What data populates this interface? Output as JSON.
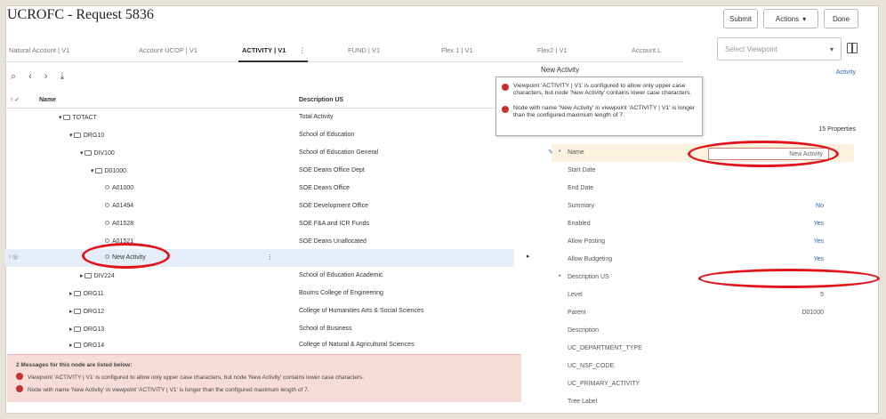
{
  "window": {
    "title": "UCROFC - Request 5836",
    "actions": {
      "submit": "Submit",
      "actions": "Actions",
      "done": "Done"
    }
  },
  "tabs": [
    {
      "label": "Natural Account | V1"
    },
    {
      "label": "Account UCOP | V1"
    },
    {
      "label": "ACTIVITY | V1"
    },
    {
      "label": "FUND | V1"
    },
    {
      "label": "Flex 1 | V1"
    },
    {
      "label": "Flex2 | V1"
    },
    {
      "label": "Account L"
    }
  ],
  "viewpoint": {
    "placeholder": "Select Viewpoint"
  },
  "tree": {
    "header": {
      "name": "Name",
      "description": "Description US"
    },
    "rows": [
      {
        "name": "TOTACT",
        "description": "Total Activity"
      },
      {
        "name": "ORG10",
        "description": "School of Education"
      },
      {
        "name": "DIV100",
        "description": "School of Education General"
      },
      {
        "name": "D01000",
        "description": "SOE Deans Office Dept"
      },
      {
        "name": "A01000",
        "description": "SOE Deans Office"
      },
      {
        "name": "A01494",
        "description": "SOE Development Office"
      },
      {
        "name": "A01528",
        "description": "SOE F&A and ICR Funds"
      },
      {
        "name": "A01521",
        "description": "SOE Deans Unallocated"
      },
      {
        "name": "New Activity",
        "description": ""
      },
      {
        "name": "DIV224",
        "description": "School of Education Academic"
      },
      {
        "name": "ORG11",
        "description": "Bourns College of Engineering"
      },
      {
        "name": "ORG12",
        "description": "College of Humanities Arts & Social Sciences"
      },
      {
        "name": "ORG13",
        "description": "School of Business"
      },
      {
        "name": "ORG14",
        "description": "College of Natural & Agricultural Sciences"
      }
    ]
  },
  "messages": {
    "title": "2 Messages for this node are listed below:",
    "items": [
      "Viewpoint 'ACTIVITY | V1' is configured to allow only upper case characters, but node 'New Activity' contains lower case characters.",
      "Node with name 'New Activity' in viewpoint 'ACTIVITY | V1' is longer than the configured maximum length of 7."
    ]
  },
  "tooltip": {
    "items": [
      "Viewpoint 'ACTIVITY | V1' is configured to allow only upper case characters, but node 'New Activity' contains lower case characters.",
      "Node with name 'New Activity' in viewpoint 'ACTIVITY | V1' is longer than the configured maximum length of 7."
    ]
  },
  "details": {
    "title": "New Activity",
    "type_link": "Activity",
    "properties_count": "15 Properties",
    "properties": [
      {
        "label": "Name",
        "value": "New Activity"
      },
      {
        "label": "Start Date",
        "value": ""
      },
      {
        "label": "End Date",
        "value": ""
      },
      {
        "label": "Summary",
        "value": "No"
      },
      {
        "label": "Enabled",
        "value": "Yes"
      },
      {
        "label": "Allow Posting",
        "value": "Yes"
      },
      {
        "label": "Allow Budgeting",
        "value": "Yes"
      },
      {
        "label": "Description US",
        "value": ""
      },
      {
        "label": "Level",
        "value": "5"
      },
      {
        "label": "Parent",
        "value": "D01000"
      },
      {
        "label": "Description",
        "value": ""
      },
      {
        "label": "UC_DEPARTMENT_TYPE",
        "value": ""
      },
      {
        "label": "UC_NSF_CODE",
        "value": ""
      },
      {
        "label": "UC_PRIMARY_ACTIVITY",
        "value": ""
      },
      {
        "label": "Tree Label",
        "value": ""
      }
    ]
  },
  "colors": {
    "error": "#c3332f",
    "link": "#2a66b8",
    "highlight": "#e1141c"
  }
}
